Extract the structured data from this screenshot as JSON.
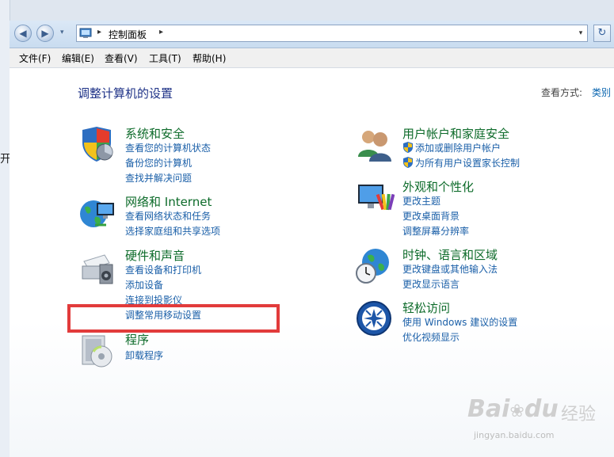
{
  "window": {
    "left_fragment": "开",
    "address": {
      "breadcrumb": "控制面板",
      "arrow": "▸",
      "drop": "▾"
    },
    "nav": {
      "back": "◀",
      "forward": "▶",
      "history_drop": "▾",
      "refresh": "↻"
    }
  },
  "menu": [
    {
      "label": "文件(F)"
    },
    {
      "label": "编辑(E)"
    },
    {
      "label": "查看(V)"
    },
    {
      "label": "工具(T)"
    },
    {
      "label": "帮助(H)"
    }
  ],
  "content": {
    "title": "调整计算机的设置",
    "view_by_label": "查看方式:",
    "view_by_value": "类别"
  },
  "categories": {
    "system": {
      "title": "系统和安全",
      "icon": "shield-icon",
      "links": [
        "查看您的计算机状态",
        "备份您的计算机",
        "查找并解决问题"
      ]
    },
    "network": {
      "title": "网络和 Internet",
      "icon": "network-globe-icon",
      "links": [
        "查看网络状态和任务",
        "选择家庭组和共享选项"
      ]
    },
    "hardware": {
      "title": "硬件和声音",
      "icon": "printer-speaker-icon",
      "links": [
        "查看设备和打印机",
        "添加设备",
        "连接到投影仪",
        "调整常用移动设置"
      ]
    },
    "programs": {
      "title": "程序",
      "icon": "programs-disc-icon",
      "links": [
        "卸载程序"
      ]
    },
    "users": {
      "title": "用户帐户和家庭安全",
      "icon": "users-icon",
      "links": [
        "添加或删除用户帐户",
        "为所有用户设置家长控制"
      ]
    },
    "appearance": {
      "title": "外观和个性化",
      "icon": "monitor-palette-icon",
      "links": [
        "更改主题",
        "更改桌面背景",
        "调整屏幕分辨率"
      ]
    },
    "clock": {
      "title": "时钟、语言和区域",
      "icon": "clock-globe-icon",
      "links": [
        "更改键盘或其他输入法",
        "更改显示语言"
      ]
    },
    "ease": {
      "title": "轻松访问",
      "icon": "ease-of-access-icon",
      "links": [
        "使用 Windows 建议的设置",
        "优化视频显示"
      ]
    }
  },
  "watermark": {
    "brand": "Bai",
    "brand_tail": "du",
    "cn": "经验",
    "url": "jingyan.baidu.com"
  },
  "colors": {
    "accent_link": "#1a5fa8",
    "category_title": "#0d6b2a",
    "highlight": "#e23b3b"
  }
}
